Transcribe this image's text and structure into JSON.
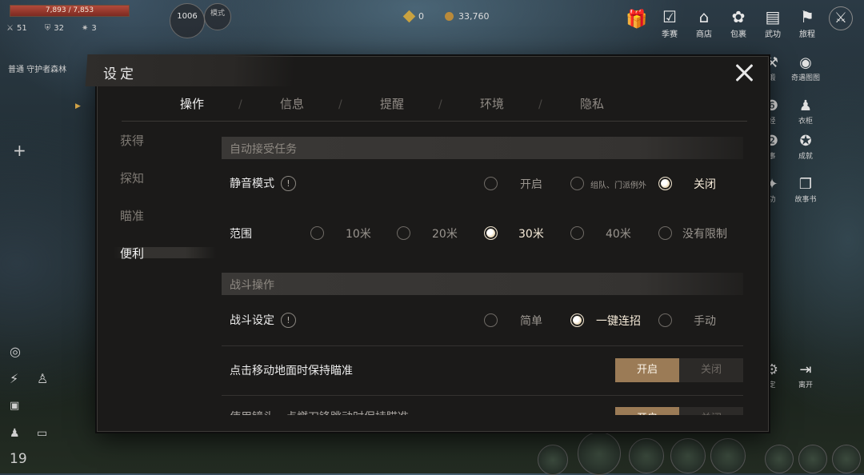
{
  "hud": {
    "hp_text": "7,893 / 7,853",
    "hp_fraction": 1.0,
    "stats": [
      {
        "icon": "sword-icon",
        "value": "51"
      },
      {
        "icon": "shield-icon",
        "value": "32"
      },
      {
        "icon": "sparkle-icon",
        "value": "3"
      }
    ],
    "level": "1006",
    "mode_label": "模式",
    "location": "普通  守护者森林",
    "currency": [
      {
        "icon": "gold-coin-icon",
        "value": "0",
        "color": "#c9a240"
      },
      {
        "icon": "copper-coin-icon",
        "value": "33,760",
        "color": "#b98a3a"
      }
    ],
    "top_menu": [
      {
        "icon": "calendar-check-icon",
        "label": "季赛"
      },
      {
        "icon": "shop-icon",
        "label": "商店"
      },
      {
        "icon": "bag-icon",
        "label": "包裹"
      },
      {
        "icon": "book-icon",
        "label": "武功"
      },
      {
        "icon": "flag-icon",
        "label": "旅程"
      }
    ],
    "side_menu": [
      {
        "icon": "forge-icon",
        "label": "锻"
      },
      {
        "icon": "wonder-icon",
        "label": "奇遇图图"
      },
      {
        "icon": "meridian-icon",
        "label": "经"
      },
      {
        "icon": "wardrobe-icon",
        "label": "衣柜"
      },
      {
        "icon": "event-icon",
        "label": "事"
      },
      {
        "icon": "achievement-icon",
        "label": "成就"
      },
      {
        "icon": "skill-icon",
        "label": "功"
      },
      {
        "icon": "story-book-icon",
        "label": "故事书"
      }
    ],
    "bottom_menu": [
      {
        "icon": "gear-icon",
        "label": "定"
      },
      {
        "icon": "exit-icon",
        "label": "离开"
      }
    ],
    "bottom_left_value": "19"
  },
  "dialog": {
    "title": "设定",
    "tabs": [
      "操作",
      "信息",
      "提醒",
      "环境",
      "隐私"
    ],
    "active_tab": 0,
    "subnav": [
      "获得",
      "探知",
      "瞄准",
      "便利"
    ],
    "active_subnav": 3,
    "sections": [
      {
        "header": "自动接受任务"
      },
      {
        "header": "战斗操作"
      }
    ],
    "rows": {
      "mute": {
        "label": "静音模式",
        "options": [
          "开启",
          "组队、门派例外",
          "关闭"
        ],
        "selected": 2
      },
      "range": {
        "label": "范围",
        "options": [
          "10米",
          "20米",
          "30米",
          "40米",
          "没有限制"
        ],
        "selected": 2
      },
      "combat": {
        "label": "战斗设定",
        "options": [
          "简单",
          "一键连招",
          "手动"
        ],
        "selected": 1
      },
      "aim_keep": {
        "label": "点击移动地面时保持瞄准",
        "on_label": "开启",
        "off_label": "关闭",
        "value": "开启"
      },
      "cut_row": {
        "label": "使用镜头，点燃刀锋跳动时保持瞄准",
        "on_label": "开启",
        "off_label": "关闭"
      }
    },
    "accent_color": "#9b7b56"
  }
}
